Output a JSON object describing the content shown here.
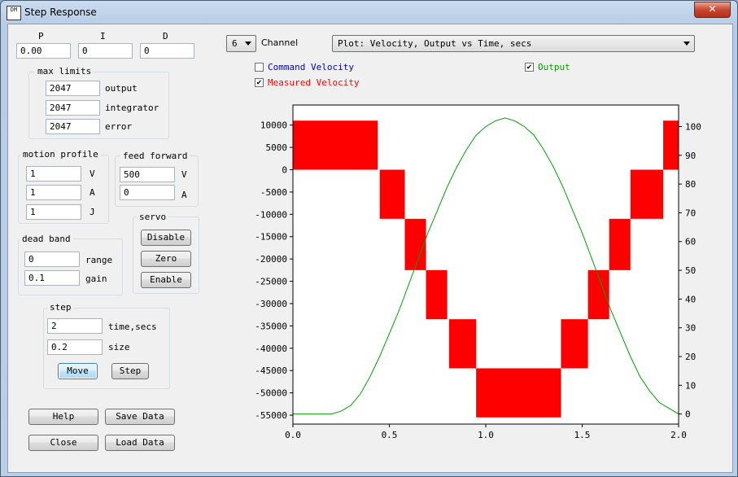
{
  "window": {
    "title": "Step Response",
    "close_label": "✕",
    "icon_text": "DM"
  },
  "pid": {
    "p_label": "P",
    "i_label": "I",
    "d_label": "D",
    "p_value": "0.00",
    "i_value": "0",
    "d_value": "0"
  },
  "max_limits": {
    "title": "max limits",
    "output_value": "2047",
    "output_label": "output",
    "integrator_value": "2047",
    "integrator_label": "integrator",
    "error_value": "2047",
    "error_label": "error"
  },
  "motion_profile": {
    "title": "motion profile",
    "v_value": "1",
    "v_label": "V",
    "a_value": "1",
    "a_label": "A",
    "j_value": "1",
    "j_label": "J"
  },
  "feed_forward": {
    "title": "feed forward",
    "v_value": "500",
    "v_label": "V",
    "a_value": "0",
    "a_label": "A"
  },
  "servo": {
    "title": "servo",
    "disable_label": "Disable",
    "zero_label": "Zero",
    "enable_label": "Enable"
  },
  "dead_band": {
    "title": "dead band",
    "range_value": "0",
    "range_label": "range",
    "gain_value": "0.1",
    "gain_label": "gain"
  },
  "step": {
    "title": "step",
    "time_value": "2",
    "time_label": "time,secs",
    "size_value": "0.2",
    "size_label": "size",
    "move_label": "Move",
    "step_label": "Step"
  },
  "footer": {
    "help_label": "Help",
    "save_label": "Save Data",
    "close_label": "Close",
    "load_label": "Load Data"
  },
  "channel": {
    "value": "6",
    "label": "Channel"
  },
  "plot_select": {
    "value": "Plot: Velocity, Output vs Time, secs"
  },
  "legend": {
    "command_velocity": {
      "label": "Command Velocity",
      "checked": false,
      "color": "#0000cc"
    },
    "measured_velocity": {
      "label": "Measured Velocity",
      "checked": true,
      "color": "#ff0000"
    },
    "output": {
      "label": "Output",
      "checked": true,
      "color": "#00a000"
    },
    "check_mark": "✔"
  },
  "chart_data": {
    "type": "line",
    "title": "",
    "xlabel": "",
    "ylabel": "",
    "xlim": [
      0,
      2
    ],
    "ylim_left": [
      -57000,
      14500
    ],
    "ylim_right": [
      -3.5,
      107.5
    ],
    "x_ticks": [
      "0.0",
      "0.5",
      "1.0",
      "1.5",
      "2.0"
    ],
    "x_tick_values": [
      0,
      0.5,
      1.0,
      1.5,
      2.0
    ],
    "y_left_ticks": [
      10000,
      5000,
      0,
      -5000,
      -10000,
      -15000,
      -20000,
      -25000,
      -30000,
      -35000,
      -40000,
      -45000,
      -50000,
      -55000
    ],
    "y_right_ticks": [
      100,
      90,
      80,
      70,
      60,
      50,
      40,
      30,
      20,
      10,
      0
    ],
    "series": [
      {
        "name": "Measured Velocity",
        "axis": "left",
        "color": "#ff0000",
        "style": "filled-steps",
        "segments": [
          {
            "x0": 0.0,
            "x1": 0.44,
            "lo": 0,
            "hi": 11000
          },
          {
            "x0": 0.45,
            "x1": 0.58,
            "lo": -11000,
            "hi": 0
          },
          {
            "x0": 0.58,
            "x1": 0.69,
            "lo": -22500,
            "hi": -11000
          },
          {
            "x0": 0.69,
            "x1": 0.8,
            "lo": -33500,
            "hi": -22500
          },
          {
            "x0": 0.81,
            "x1": 0.95,
            "lo": -44500,
            "hi": -33500
          },
          {
            "x0": 0.95,
            "x1": 1.39,
            "lo": -55500,
            "hi": -44500
          },
          {
            "x0": 1.39,
            "x1": 1.53,
            "lo": -44500,
            "hi": -33500
          },
          {
            "x0": 1.53,
            "x1": 1.64,
            "lo": -33500,
            "hi": -22500
          },
          {
            "x0": 1.64,
            "x1": 1.75,
            "lo": -22500,
            "hi": -11000
          },
          {
            "x0": 1.75,
            "x1": 1.92,
            "lo": -11000,
            "hi": 0
          },
          {
            "x0": 1.92,
            "x1": 2.0,
            "lo": 0,
            "hi": 11000
          }
        ]
      },
      {
        "name": "Output",
        "axis": "right",
        "color": "#00a000",
        "x": [
          0,
          0.1,
          0.2,
          0.25,
          0.3,
          0.35,
          0.4,
          0.45,
          0.5,
          0.55,
          0.6,
          0.65,
          0.7,
          0.75,
          0.8,
          0.85,
          0.9,
          0.95,
          1.0,
          1.05,
          1.1,
          1.15,
          1.2,
          1.25,
          1.3,
          1.35,
          1.4,
          1.45,
          1.5,
          1.55,
          1.6,
          1.65,
          1.7,
          1.75,
          1.8,
          1.85,
          1.9,
          1.95,
          2.0
        ],
        "y": [
          0,
          0,
          0,
          1,
          3,
          7,
          13,
          20,
          28,
          36,
          45,
          54,
          63,
          71,
          79,
          86,
          92,
          97,
          100,
          102,
          103,
          102,
          100,
          97,
          92,
          86,
          79,
          71,
          63,
          54,
          45,
          36,
          28,
          20,
          13,
          8,
          4,
          2,
          0
        ]
      }
    ]
  }
}
